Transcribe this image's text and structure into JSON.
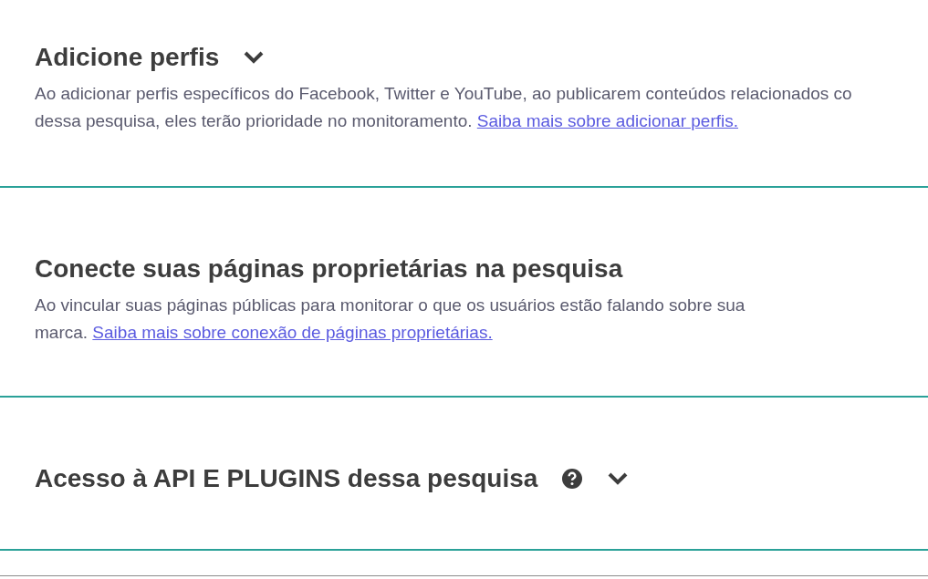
{
  "sections": [
    {
      "title": "Adicione perfis",
      "collapsible": true,
      "has_help": false,
      "description_lines": [
        "Ao adicionar perfis específicos do Facebook, Twitter e YouTube, ao publicarem conteúdos relacionados co",
        "dessa pesquisa, eles terão prioridade no monitoramento."
      ],
      "link": "Saiba mais sobre adicionar perfis."
    },
    {
      "title": "Conecte suas páginas proprietárias na pesquisa",
      "collapsible": false,
      "has_help": false,
      "description_lines": [
        "Ao vincular suas páginas públicas para monitorar o que os usuários estão falando sobre sua",
        "marca."
      ],
      "link": "Saiba mais sobre conexão de páginas proprietárias."
    },
    {
      "title": "Acesso à API E PLUGINS dessa pesquisa",
      "collapsible": true,
      "has_help": true
    }
  ]
}
